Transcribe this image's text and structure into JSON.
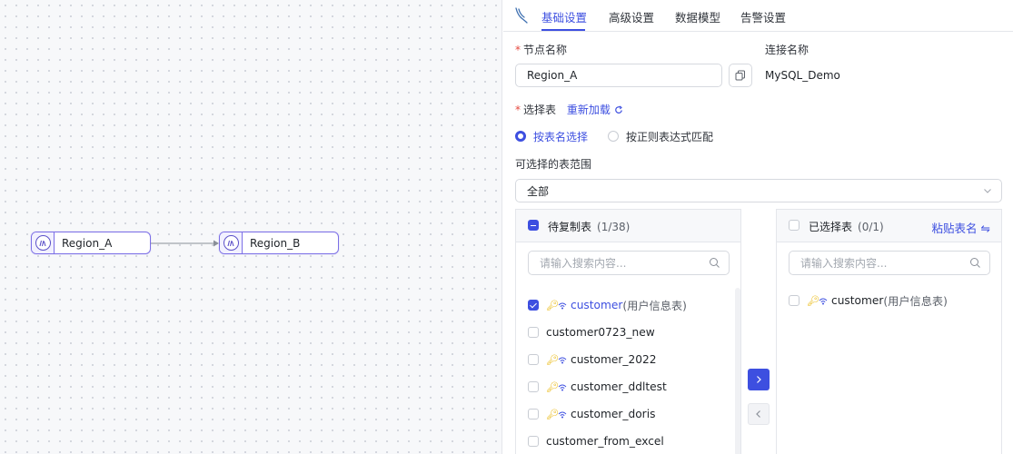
{
  "canvas": {
    "nodes": [
      {
        "label": "Region_A"
      },
      {
        "label": "Region_B"
      }
    ]
  },
  "tabs": [
    "基础设置",
    "高级设置",
    "数据模型",
    "告警设置"
  ],
  "form": {
    "node_name_label": "节点名称",
    "node_name_value": "Region_A",
    "connection_label": "连接名称",
    "connection_value": "MySQL_Demo",
    "select_table_label": "选择表",
    "reload_label": "重新加载",
    "radio_by_name": "按表名选择",
    "radio_by_regex": "按正则表达式匹配",
    "range_label": "可选择的表范围",
    "range_value": "全部"
  },
  "source_list": {
    "title": "待复制表",
    "count": "(1/38)",
    "search_placeholder": "请输入搜索内容...",
    "rows": [
      {
        "name": "customer",
        "sub": "(用户信息表)",
        "checked": true,
        "key": true
      },
      {
        "name": "customer0723_new",
        "sub": "",
        "checked": false,
        "key": false
      },
      {
        "name": "customer_2022",
        "sub": "",
        "checked": false,
        "key": true
      },
      {
        "name": "customer_ddltest",
        "sub": "",
        "checked": false,
        "key": true
      },
      {
        "name": "customer_doris",
        "sub": "",
        "checked": false,
        "key": true
      },
      {
        "name": "customer_from_excel",
        "sub": "",
        "checked": false,
        "key": false
      }
    ]
  },
  "target_list": {
    "title": "已选择表",
    "count": "(0/1)",
    "paste_label": "粘贴表名",
    "search_placeholder": "请输入搜索内容...",
    "rows": [
      {
        "name": "customer",
        "sub": "(用户信息表)"
      }
    ]
  },
  "colors": {
    "accent": "#3d4fe0",
    "node_border": "#7c6fe6",
    "key": "#e8b400",
    "required": "#e5483e"
  },
  "icons": {
    "logo": "mysql-dolphin-icon",
    "copy": "copy-icon",
    "reload": "refresh-icon",
    "search": "search-icon",
    "key": "key-icon",
    "signal": "wifi-icon"
  }
}
